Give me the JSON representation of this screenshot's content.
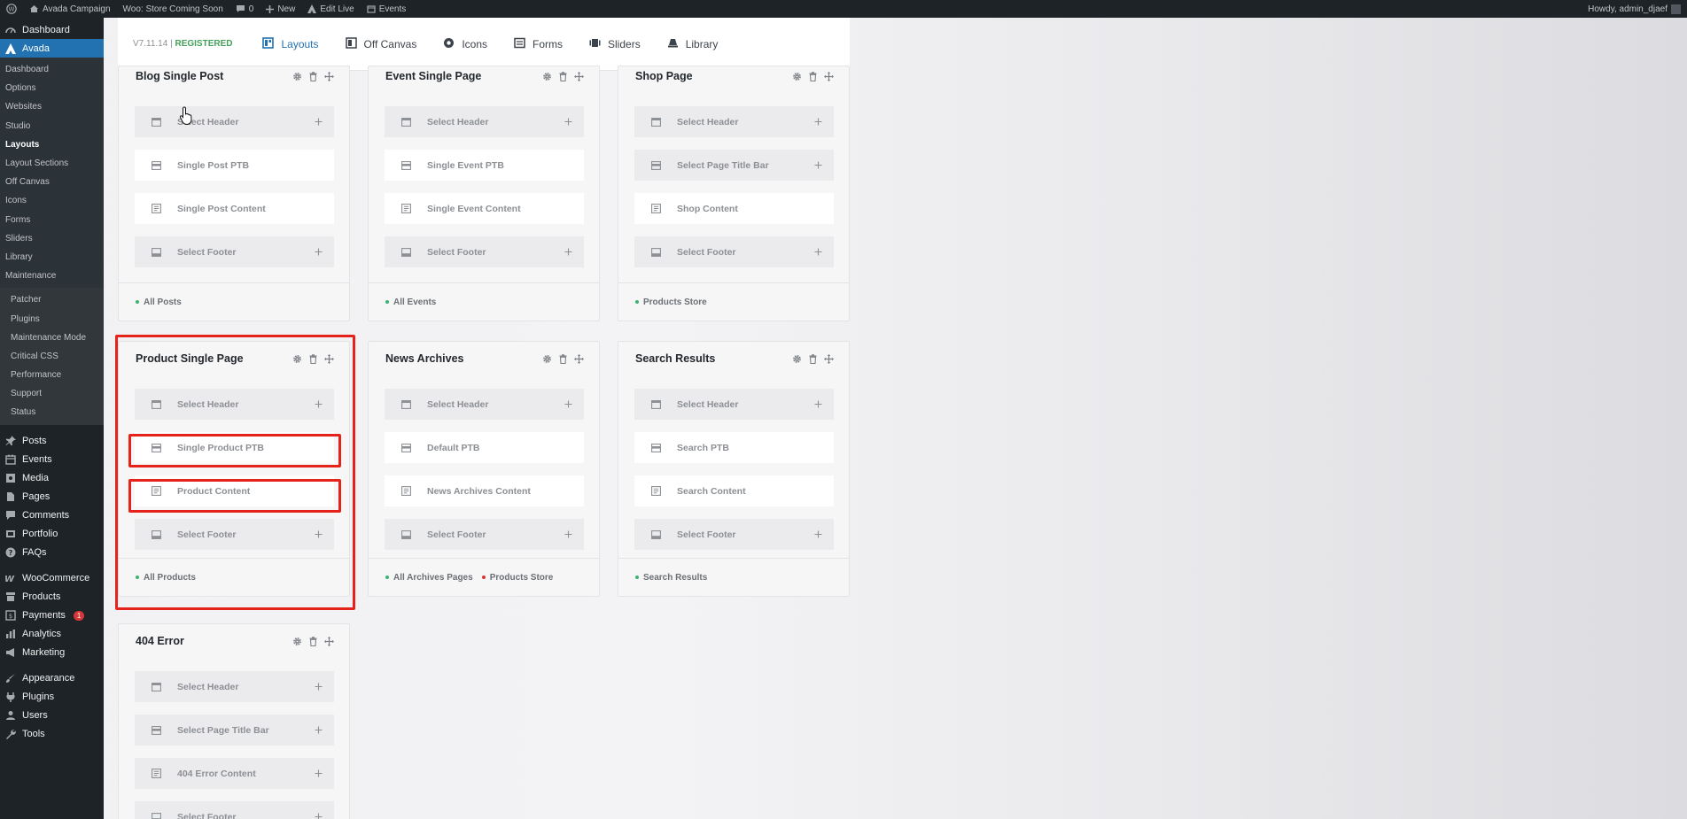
{
  "admin_bar": {
    "site_name": "Avada Campaign",
    "store_notice": "Woo: Store Coming Soon",
    "comments_count": "0",
    "new_label": "New",
    "edit_live_label": "Edit Live",
    "events_label": "Events",
    "greeting": "Howdy, admin_djaef"
  },
  "sidebar": {
    "top": [
      {
        "label": "Dashboard",
        "icon": "dashboard-icon"
      },
      {
        "label": "Avada",
        "icon": "avada-icon"
      }
    ],
    "avada_submenu": [
      "Dashboard",
      "Options",
      "Websites",
      "Studio",
      "Layouts",
      "Layout Sections",
      "Off Canvas",
      "Icons",
      "Forms",
      "Sliders",
      "Library",
      "Maintenance"
    ],
    "maintenance_submenu": [
      "Patcher",
      "Plugins",
      "Maintenance Mode",
      "Critical CSS",
      "Performance",
      "Support",
      "Status"
    ],
    "group1": [
      {
        "label": "Posts",
        "icon": "pin-icon"
      },
      {
        "label": "Events",
        "icon": "calendar-icon"
      },
      {
        "label": "Media",
        "icon": "media-icon"
      },
      {
        "label": "Pages",
        "icon": "page-icon"
      },
      {
        "label": "Comments",
        "icon": "comment-icon"
      },
      {
        "label": "Portfolio",
        "icon": "portfolio-icon"
      },
      {
        "label": "FAQs",
        "icon": "help-icon"
      }
    ],
    "group2": [
      {
        "label": "WooCommerce",
        "icon": "woo-icon"
      },
      {
        "label": "Products",
        "icon": "archive-icon"
      },
      {
        "label": "Payments",
        "icon": "payments-icon",
        "badge": "1"
      },
      {
        "label": "Analytics",
        "icon": "chart-icon"
      },
      {
        "label": "Marketing",
        "icon": "megaphone-icon"
      }
    ],
    "group3": [
      {
        "label": "Appearance",
        "icon": "brush-icon"
      },
      {
        "label": "Plugins",
        "icon": "plugin-icon"
      },
      {
        "label": "Users",
        "icon": "user-icon"
      },
      {
        "label": "Tools",
        "icon": "wrench-icon"
      }
    ]
  },
  "header": {
    "version": "V7.11.14",
    "separator": "|",
    "status": "REGISTERED",
    "tabs": [
      {
        "label": "Layouts",
        "icon": "layouts-icon",
        "active": true
      },
      {
        "label": "Off Canvas",
        "icon": "off-canvas-icon"
      },
      {
        "label": "Icons",
        "icon": "icons-icon"
      },
      {
        "label": "Forms",
        "icon": "forms-icon"
      },
      {
        "label": "Sliders",
        "icon": "sliders-icon"
      },
      {
        "label": "Library",
        "icon": "library-icon"
      }
    ]
  },
  "layouts": [
    {
      "title": "Blog Single Post",
      "slots": [
        {
          "label": "Select Header",
          "type": "header",
          "state": "empty"
        },
        {
          "label": "Single Post PTB",
          "type": "ptb",
          "state": "filled"
        },
        {
          "label": "Single Post Content",
          "type": "content",
          "state": "filled"
        },
        {
          "label": "Select Footer",
          "type": "footer",
          "state": "empty"
        }
      ],
      "conditions": [
        {
          "label": "All Posts",
          "color": "#3cb371"
        }
      ]
    },
    {
      "title": "Event Single Page",
      "slots": [
        {
          "label": "Select Header",
          "type": "header",
          "state": "empty"
        },
        {
          "label": "Single Event PTB",
          "type": "ptb",
          "state": "filled"
        },
        {
          "label": "Single Event Content",
          "type": "content",
          "state": "filled"
        },
        {
          "label": "Select Footer",
          "type": "footer",
          "state": "empty"
        }
      ],
      "conditions": [
        {
          "label": "All Events",
          "color": "#3cb371"
        }
      ]
    },
    {
      "title": "Shop Page",
      "slots": [
        {
          "label": "Select Header",
          "type": "header",
          "state": "empty"
        },
        {
          "label": "Select Page Title Bar",
          "type": "ptb",
          "state": "empty"
        },
        {
          "label": "Shop Content",
          "type": "content",
          "state": "filled"
        },
        {
          "label": "Select Footer",
          "type": "footer",
          "state": "empty"
        }
      ],
      "conditions": [
        {
          "label": "Products Store",
          "color": "#3cb371"
        }
      ]
    },
    {
      "title": "Product Single Page",
      "slots": [
        {
          "label": "Select Header",
          "type": "header",
          "state": "empty"
        },
        {
          "label": "Single Product PTB",
          "type": "ptb",
          "state": "filled"
        },
        {
          "label": "Product Content",
          "type": "content",
          "state": "filled"
        },
        {
          "label": "Select Footer",
          "type": "footer",
          "state": "empty"
        }
      ],
      "conditions": [
        {
          "label": "All Products",
          "color": "#3cb371"
        }
      ]
    },
    {
      "title": "News Archives",
      "slots": [
        {
          "label": "Select Header",
          "type": "header",
          "state": "empty"
        },
        {
          "label": "Default PTB",
          "type": "ptb",
          "state": "filled"
        },
        {
          "label": "News Archives Content",
          "type": "content",
          "state": "filled"
        },
        {
          "label": "Select Footer",
          "type": "footer",
          "state": "empty"
        }
      ],
      "conditions": [
        {
          "label": "All Archives Pages",
          "color": "#3cb371"
        },
        {
          "label": "Products Store",
          "color": "#d63638"
        }
      ]
    },
    {
      "title": "Search Results",
      "slots": [
        {
          "label": "Select Header",
          "type": "header",
          "state": "empty"
        },
        {
          "label": "Search PTB",
          "type": "ptb",
          "state": "filled"
        },
        {
          "label": "Search Content",
          "type": "content",
          "state": "filled"
        },
        {
          "label": "Select Footer",
          "type": "footer",
          "state": "empty"
        }
      ],
      "conditions": [
        {
          "label": "Search Results",
          "color": "#3cb371"
        }
      ]
    },
    {
      "title": "404 Error",
      "slots": [
        {
          "label": "Select Header",
          "type": "header",
          "state": "empty"
        },
        {
          "label": "Select Page Title Bar",
          "type": "ptb",
          "state": "empty"
        },
        {
          "label": "404 Error Content",
          "type": "content",
          "state": "empty"
        },
        {
          "label": "Select Footer",
          "type": "footer",
          "state": "empty"
        }
      ],
      "conditions": []
    }
  ],
  "colors": {
    "accent": "#2271b1",
    "highlight": "#e5231b",
    "registered": "#46a05b"
  }
}
